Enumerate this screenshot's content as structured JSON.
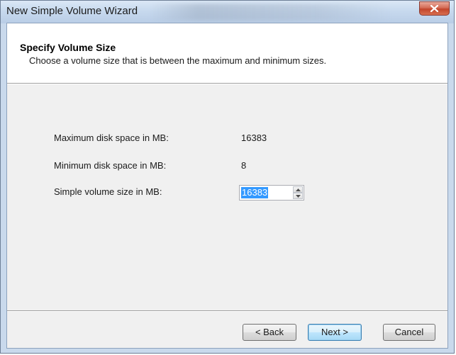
{
  "window": {
    "title": "New Simple Volume Wizard",
    "close_glyph": "X"
  },
  "header": {
    "title": "Specify Volume Size",
    "subtitle": "Choose a volume size that is between the maximum and minimum sizes."
  },
  "fields": {
    "max_label": "Maximum disk space in MB:",
    "max_value": "16383",
    "min_label": "Minimum disk space in MB:",
    "min_value": "8",
    "size_label": "Simple volume size in MB:",
    "size_value": "16383"
  },
  "buttons": {
    "back": "< Back",
    "next": "Next >",
    "cancel": "Cancel"
  },
  "icons": {
    "close": "close-icon",
    "spin_up": "chevron-up-icon",
    "spin_down": "chevron-down-icon"
  },
  "colors": {
    "selection": "#3399ff",
    "close_button": "#c2452b",
    "default_button_border": "#3c7fb1"
  }
}
